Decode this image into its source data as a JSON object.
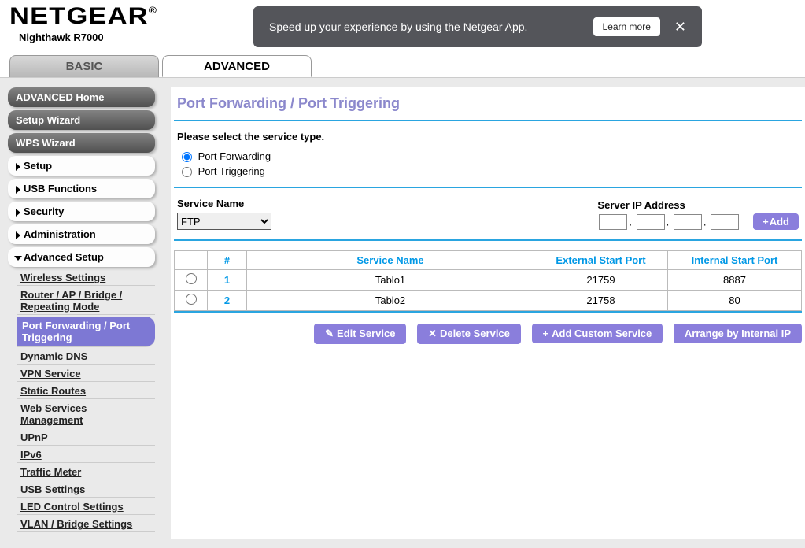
{
  "brand": {
    "name": "NETGEAR",
    "reg": "®",
    "model": "Nighthawk R7000"
  },
  "notif": {
    "text": "Speed up your experience by using the Netgear App.",
    "learn_more": "Learn more"
  },
  "tabs": {
    "basic": "BASIC",
    "advanced": "ADVANCED"
  },
  "sidebar": {
    "advanced_home": "ADVANCED Home",
    "setup_wizard": "Setup Wizard",
    "wps_wizard": "WPS Wizard",
    "setup": "Setup",
    "usb_functions": "USB Functions",
    "security": "Security",
    "administration": "Administration",
    "advanced_setup": "Advanced Setup",
    "sub": {
      "wireless": "Wireless Settings",
      "router_ap": "Router / AP / Bridge / Repeating Mode",
      "port_forward": "Port Forwarding / Port Triggering",
      "ddns": "Dynamic DNS",
      "vpn": "VPN Service",
      "static_routes": "Static Routes",
      "wsm": "Web Services Management",
      "upnp": "UPnP",
      "ipv6": "IPv6",
      "traffic": "Traffic Meter",
      "usb_settings": "USB Settings",
      "led": "LED Control Settings",
      "vlan": "VLAN / Bridge Settings"
    }
  },
  "page": {
    "title": "Port Forwarding / Port Triggering",
    "select_type": "Please select the service type.",
    "radio_pf": "Port Forwarding",
    "radio_pt": "Port Triggering",
    "service_name_label": "Service Name",
    "service_name_value": "FTP",
    "server_ip_label": "Server IP Address",
    "add_btn": "Add"
  },
  "table": {
    "headers": {
      "sel": "",
      "num": "#",
      "service": "Service Name",
      "ext": "External Start Port",
      "int": "Internal Start Port"
    },
    "rows": [
      {
        "num": "1",
        "service": "Tablo1",
        "ext": "21759",
        "int": "8887"
      },
      {
        "num": "2",
        "service": "Tablo2",
        "ext": "21758",
        "int": "80"
      }
    ]
  },
  "actions": {
    "edit": "Edit Service",
    "delete": "Delete Service",
    "add_custom": "Add Custom Service",
    "arrange": "Arrange by Internal IP"
  }
}
